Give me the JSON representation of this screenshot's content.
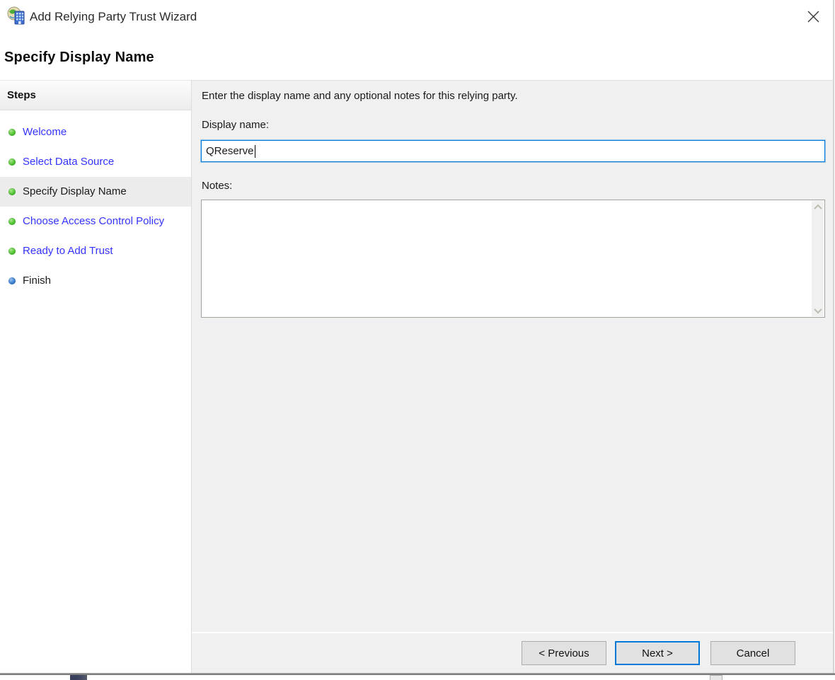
{
  "window": {
    "title": "Add Relying Party Trust Wizard",
    "app_icon": "adfs-wizard-icon",
    "close_icon": "close-icon"
  },
  "page": {
    "heading": "Specify Display Name",
    "intro": "Enter the display name and any optional notes for this relying party."
  },
  "sidebar": {
    "header": "Steps",
    "steps": [
      {
        "label": "Welcome",
        "status": "completed",
        "current": false
      },
      {
        "label": "Select Data Source",
        "status": "completed",
        "current": false
      },
      {
        "label": "Specify Display Name",
        "status": "completed",
        "current": true
      },
      {
        "label": "Choose Access Control Policy",
        "status": "completed",
        "current": false
      },
      {
        "label": "Ready to Add Trust",
        "status": "completed",
        "current": false
      },
      {
        "label": "Finish",
        "status": "pending",
        "current": false
      }
    ]
  },
  "form": {
    "display_name_label": "Display name:",
    "display_name_value": "QReserve",
    "notes_label": "Notes:",
    "notes_value": ""
  },
  "footer": {
    "previous_label": "< Previous",
    "next_label": "Next >",
    "cancel_label": "Cancel"
  },
  "colors": {
    "step_link": "#3333ff",
    "focus_border": "#0078d7",
    "content_bg": "#f0f0f0",
    "completed_dot": "#52c234",
    "pending_dot": "#3d7fd1",
    "button_bg": "#e1e1e1",
    "button_border": "#adadad"
  }
}
